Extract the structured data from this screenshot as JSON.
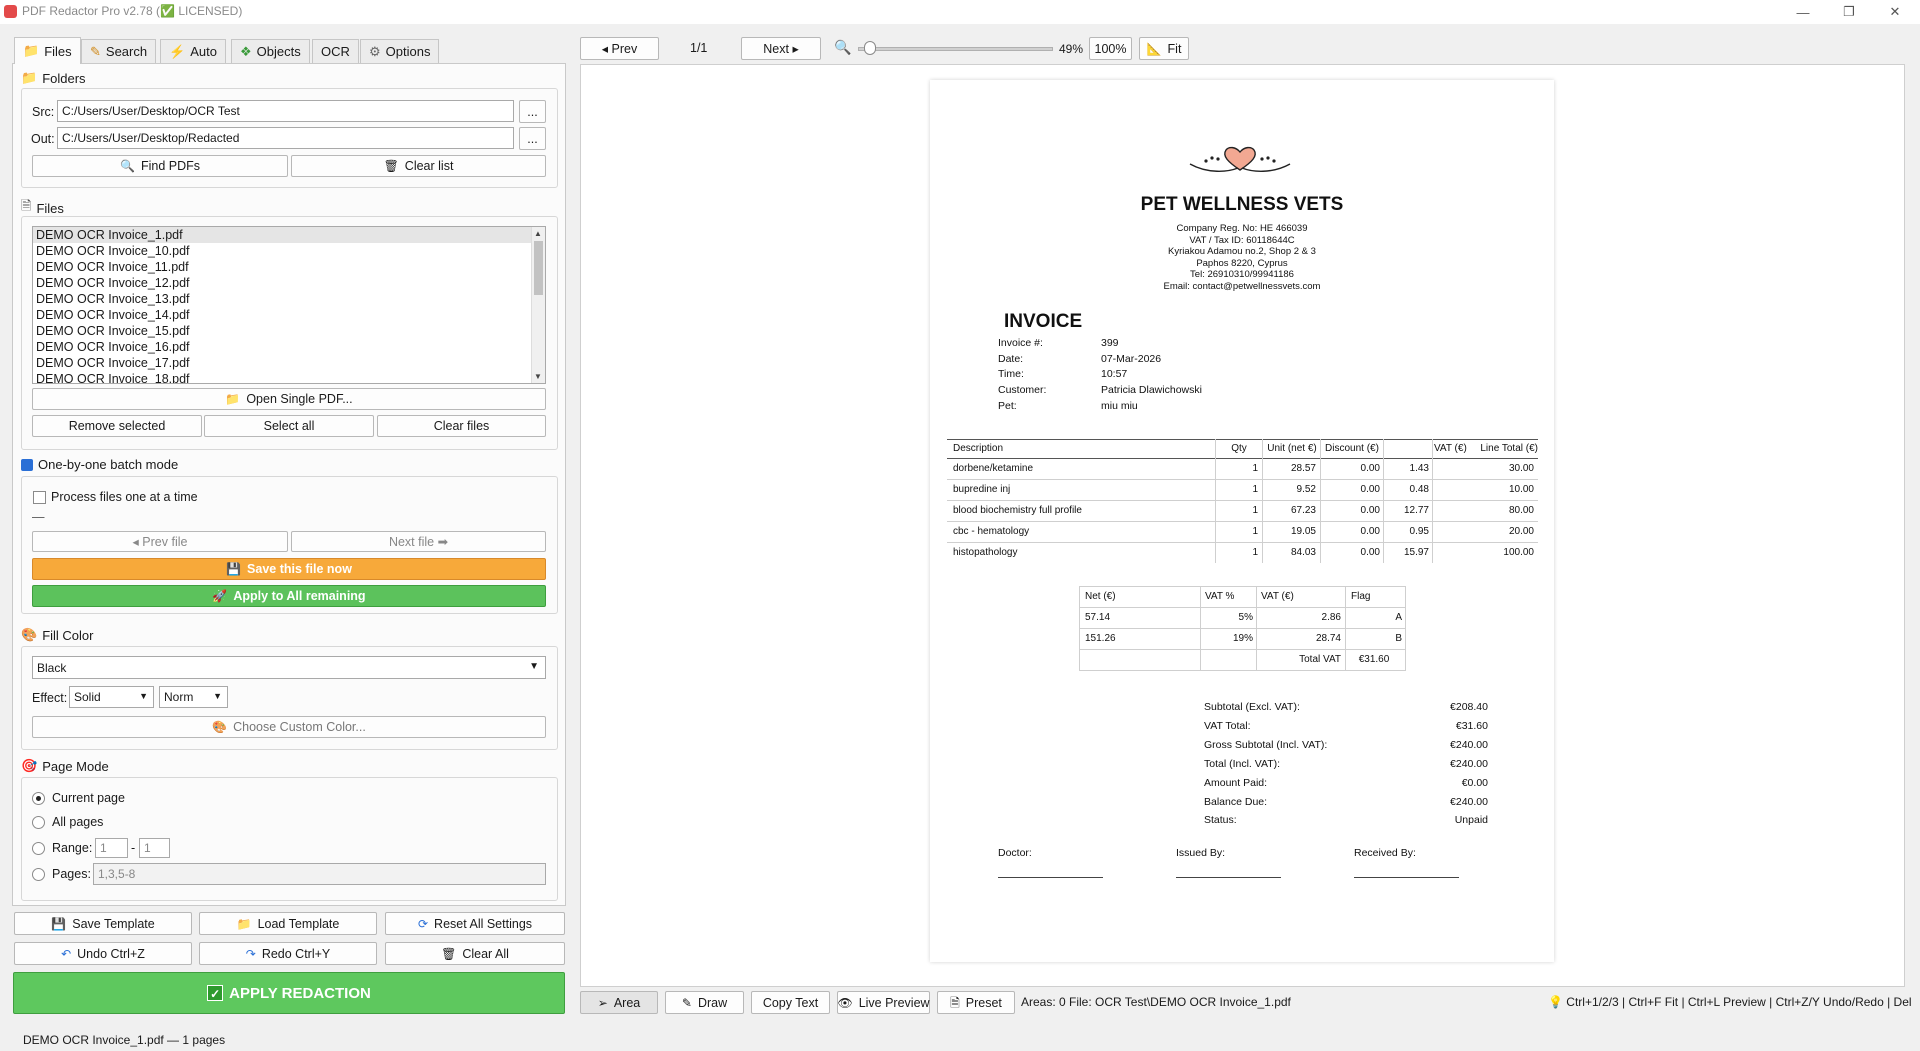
{
  "window": {
    "title": "PDF Redactor Pro v2.78 (✅ LICENSED)",
    "minimize": "—",
    "maximize": "❐",
    "close": "✕"
  },
  "tabs": [
    {
      "label": "Files",
      "icon": "folder-icon"
    },
    {
      "label": "Search",
      "icon": "pencil-icon"
    },
    {
      "label": "Auto",
      "icon": "lightning-icon"
    },
    {
      "label": "Objects",
      "icon": "puzzle-icon"
    },
    {
      "label": "OCR",
      "icon": ""
    },
    {
      "label": "Options",
      "icon": "gear-icon"
    }
  ],
  "folders": {
    "title": "Folders",
    "src_label": "Src:",
    "src_value": "C:/Users/User/Desktop/OCR Test",
    "out_label": "Out:",
    "out_value": "C:/Users/User/Desktop/Redacted",
    "browse": "...",
    "find_pdfs": "Find PDFs",
    "clear_list": "Clear list"
  },
  "files": {
    "title": "Files",
    "items": [
      "DEMO OCR Invoice_1.pdf",
      "DEMO OCR Invoice_10.pdf",
      "DEMO OCR Invoice_11.pdf",
      "DEMO OCR Invoice_12.pdf",
      "DEMO OCR Invoice_13.pdf",
      "DEMO OCR Invoice_14.pdf",
      "DEMO OCR Invoice_15.pdf",
      "DEMO OCR Invoice_16.pdf",
      "DEMO OCR Invoice_17.pdf",
      "DEMO OCR Invoice_18.pdf"
    ],
    "open_single": "Open Single PDF...",
    "remove_selected": "Remove selected",
    "select_all": "Select all",
    "clear_files": "Clear files"
  },
  "batch": {
    "title": "One-by-one batch mode",
    "process_one": "Process files one at a time",
    "dash": "—",
    "prev_file": "◂ Prev file",
    "next_file": "Next file ➡",
    "save_now": "Save this file now",
    "apply_all": "Apply to All remaining"
  },
  "fill": {
    "title": "Fill Color",
    "color_value": "Black",
    "effect_label": "Effect:",
    "effect_value": "Solid",
    "norm_value": "Norm",
    "choose_custom": "Choose Custom Color..."
  },
  "page_mode": {
    "title": "Page Mode",
    "current": "Current page",
    "all": "All pages",
    "range_label": "Range:",
    "range_from": "1",
    "range_sep": "-",
    "range_to": "1",
    "pages_label": "Pages:",
    "pages_placeholder": "1,3,5-8"
  },
  "bottom_buttons": {
    "save_template": "Save Template",
    "load_template": "Load Template",
    "reset_all": "Reset All Settings",
    "undo": "Undo  Ctrl+Z",
    "redo": "Redo  Ctrl+Y",
    "clear_all": "Clear All",
    "apply": "APPLY REDACTION"
  },
  "viewer_toolbar": {
    "prev": "◂ Prev",
    "page_counter": "1/1",
    "next": "Next ▸",
    "zoom_percent": "49%",
    "zoom_slider_fraction": 0.03,
    "zoom_100": "100%",
    "fit": "Fit"
  },
  "invoice": {
    "company": "PET WELLNESS VETS",
    "company_lines": [
      "Company Reg. No: HE 466039",
      "VAT / Tax ID: 60118644C",
      "Kyriakou Adamou no.2, Shop 2 & 3",
      "Paphos 8220, Cyprus",
      "Tel: 26910310/99941186",
      "Email: contact@petwellnessvets.com"
    ],
    "heading": "INVOICE",
    "meta": [
      {
        "label": "Invoice #:",
        "value": "399"
      },
      {
        "label": "Date:",
        "value": "07-Mar-2026"
      },
      {
        "label": "Time:",
        "value": "10:57"
      },
      {
        "label": "Customer:",
        "value": "Patricia Dlawichowski"
      },
      {
        "label": "Pet:",
        "value": "miu miu"
      }
    ],
    "items_header": [
      "Description",
      "Qty",
      "Unit (net €)",
      "Discount (€)",
      "VAT (€)",
      "Line Total (€)"
    ],
    "items": [
      [
        "dorbene/ketamine",
        "1",
        "28.57",
        "0.00",
        "1.43",
        "30.00"
      ],
      [
        "bupredine inj",
        "1",
        "9.52",
        "0.00",
        "0.48",
        "10.00"
      ],
      [
        "blood biochemistry full profile",
        "1",
        "67.23",
        "0.00",
        "12.77",
        "80.00"
      ],
      [
        "cbc - hematology",
        "1",
        "19.05",
        "0.00",
        "0.95",
        "20.00"
      ],
      [
        "histopathology",
        "1",
        "84.03",
        "0.00",
        "15.97",
        "100.00"
      ]
    ],
    "vat_header": [
      "Net (€)",
      "VAT %",
      "VAT (€)",
      "Flag"
    ],
    "vat_rows": [
      [
        "57.14",
        "5%",
        "2.86",
        "A"
      ],
      [
        "151.26",
        "19%",
        "28.74",
        "B"
      ]
    ],
    "vat_total_label": "Total VAT",
    "vat_total_value": "€31.60",
    "totals": [
      {
        "label": "Subtotal (Excl. VAT):",
        "value": "€208.40"
      },
      {
        "label": "VAT Total:",
        "value": "€31.60"
      },
      {
        "label": "Gross Subtotal (Incl. VAT):",
        "value": "€240.00"
      },
      {
        "label": "Total (Incl. VAT):",
        "value": "€240.00"
      },
      {
        "label": "Amount Paid:",
        "value": "€0.00"
      },
      {
        "label": "Balance Due:",
        "value": "€240.00"
      },
      {
        "label": "Status:",
        "value": "Unpaid"
      }
    ],
    "signatures": [
      "Doctor:",
      "Issued By:",
      "Received By:"
    ]
  },
  "viewer_bottom": {
    "area": "Area",
    "draw": "Draw",
    "copy_text": "Copy Text",
    "live_preview": "Live Preview",
    "preset": "Preset",
    "info": "Areas: 0  File: OCR Test\\DEMO OCR Invoice_1.pdf",
    "shortcuts": "Ctrl+1/2/3 | Ctrl+F Fit | Ctrl+L Preview | Ctrl+Z/Y Undo/Redo | Del"
  },
  "status": "DEMO OCR Invoice_1.pdf — 1 pages",
  "colors": {
    "save_now_bg": "#f7a93a",
    "apply_all_bg": "#5cc25c",
    "apply_bg": "#5ec85e"
  }
}
